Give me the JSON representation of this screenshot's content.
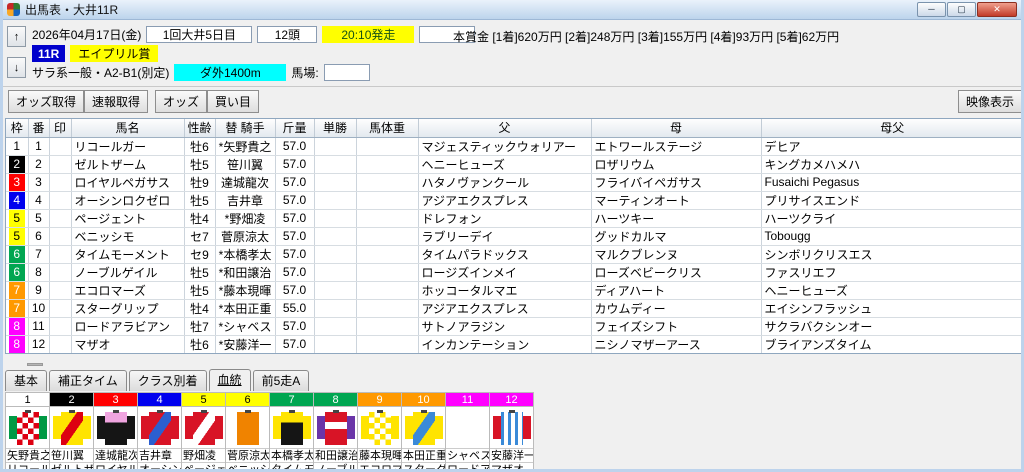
{
  "window": {
    "title": "出馬表・大井11R",
    "minimize": "─",
    "maximize": "▢",
    "close": "✕"
  },
  "header": {
    "up_arrow": "↑",
    "down_arrow": "↓",
    "date": "2026年04月17日(金)",
    "meeting": "1回大井5日目",
    "head_count": "12頭",
    "start_time": "20:10発走",
    "start_time_extra": "",
    "prize": "本賞金 [1着]620万円 [2着]248万円 [3着]155万円 [4着]93万円 [5着]62万円",
    "race_no": "11R",
    "race_name": "エイプリル賞",
    "race_class": "サラ系一般・A2-B1(別定)",
    "course": "ダ外1400m",
    "track_label": "馬場:",
    "track_value": ""
  },
  "toolbar": {
    "buttons": [
      "オッズ取得",
      "速報取得",
      "オッズ",
      "買い目"
    ],
    "video_button": "映像表示"
  },
  "frame_colors": {
    "1": {
      "bg": "#ffffff",
      "fg": "#000000"
    },
    "2": {
      "bg": "#000000",
      "fg": "#ffffff"
    },
    "3": {
      "bg": "#ff0000",
      "fg": "#ffffff"
    },
    "4": {
      "bg": "#0000ee",
      "fg": "#ffffff"
    },
    "5": {
      "bg": "#ffff00",
      "fg": "#000000"
    },
    "6": {
      "bg": "#00a651",
      "fg": "#ffffff"
    },
    "7": {
      "bg": "#ff9900",
      "fg": "#ffffff"
    },
    "8": {
      "bg": "#ff00ff",
      "fg": "#ffffff"
    }
  },
  "table": {
    "columns": [
      "枠",
      "番",
      "印",
      "馬名",
      "性齢",
      "替 騎手",
      "斤量",
      "単勝",
      "馬体重",
      "父",
      "母",
      "母父"
    ],
    "rows": [
      {
        "frame": 1,
        "num": "1",
        "mark": "",
        "name": "リコールガー",
        "sex_age": "牡6",
        "jockey": "*矢野貴之",
        "weight": "57.0",
        "odds": "",
        "body_weight": "",
        "sire": "マジェスティックウォリアー",
        "dam": "エトワールステージ",
        "dam_sire": "デヒア"
      },
      {
        "frame": 2,
        "num": "2",
        "mark": "",
        "name": "ゼルトザーム",
        "sex_age": "牡5",
        "jockey": "笹川翼",
        "weight": "57.0",
        "odds": "",
        "body_weight": "",
        "sire": "ヘニーヒューズ",
        "dam": "ロザリウム",
        "dam_sire": "キングカメハメハ"
      },
      {
        "frame": 3,
        "num": "3",
        "mark": "",
        "name": "ロイヤルペガサス",
        "sex_age": "牡9",
        "jockey": "達城龍次",
        "weight": "57.0",
        "odds": "",
        "body_weight": "",
        "sire": "ハタノヴァンクール",
        "dam": "フライバイペガサス",
        "dam_sire": "Fusaichi Pegasus"
      },
      {
        "frame": 4,
        "num": "4",
        "mark": "",
        "name": "オーシンロクゼロ",
        "sex_age": "牡5",
        "jockey": "吉井章",
        "weight": "57.0",
        "odds": "",
        "body_weight": "",
        "sire": "アジアエクスプレス",
        "dam": "マーティンオート",
        "dam_sire": "プリサイスエンド"
      },
      {
        "frame": 5,
        "num": "5",
        "mark": "",
        "name": "ページェント",
        "sex_age": "牡4",
        "jockey": "*野畑凌",
        "weight": "57.0",
        "odds": "",
        "body_weight": "",
        "sire": "ドレフォン",
        "dam": "ハーツキー",
        "dam_sire": "ハーツクライ"
      },
      {
        "frame": 5,
        "num": "6",
        "mark": "",
        "name": "ベニッシモ",
        "sex_age": "セ7",
        "jockey": "菅原涼太",
        "weight": "57.0",
        "odds": "",
        "body_weight": "",
        "sire": "ラブリーデイ",
        "dam": "グッドカルマ",
        "dam_sire": "Tobougg"
      },
      {
        "frame": 6,
        "num": "7",
        "mark": "",
        "name": "タイムモーメント",
        "sex_age": "セ9",
        "jockey": "*本橋孝太",
        "weight": "57.0",
        "odds": "",
        "body_weight": "",
        "sire": "タイムパラドックス",
        "dam": "マルクブレンヌ",
        "dam_sire": "シンボリクリスエス"
      },
      {
        "frame": 6,
        "num": "8",
        "mark": "",
        "name": "ノーブルゲイル",
        "sex_age": "牡5",
        "jockey": "*和田譲治",
        "weight": "57.0",
        "odds": "",
        "body_weight": "",
        "sire": "ロージズインメイ",
        "dam": "ローズベビークリス",
        "dam_sire": "ファスリエフ"
      },
      {
        "frame": 7,
        "num": "9",
        "mark": "",
        "name": "エコロマーズ",
        "sex_age": "牡5",
        "jockey": "*藤本現暉",
        "weight": "57.0",
        "odds": "",
        "body_weight": "",
        "sire": "ホッコータルマエ",
        "dam": "ディアハート",
        "dam_sire": "ヘニーヒューズ"
      },
      {
        "frame": 7,
        "num": "10",
        "mark": "",
        "name": "スターグリップ",
        "sex_age": "牡4",
        "jockey": "*本田正重",
        "weight": "55.0",
        "odds": "",
        "body_weight": "",
        "sire": "アジアエクスプレス",
        "dam": "カウムディー",
        "dam_sire": "エイシンフラッシュ"
      },
      {
        "frame": 8,
        "num": "11",
        "mark": "",
        "name": "ロードアラビアン",
        "sex_age": "牡7",
        "jockey": "*シャベス",
        "weight": "57.0",
        "odds": "",
        "body_weight": "",
        "sire": "サトノアラジン",
        "dam": "フェイズシフト",
        "dam_sire": "サクラバクシンオー"
      },
      {
        "frame": 8,
        "num": "12",
        "mark": "",
        "name": "マザオ",
        "sex_age": "牡6",
        "jockey": "*安藤洋一",
        "weight": "57.0",
        "odds": "",
        "body_weight": "",
        "sire": "インカンテーション",
        "dam": "ニシノマザーアース",
        "dam_sire": "ブライアンズタイム"
      }
    ]
  },
  "tabs": {
    "items": [
      "基本",
      "補正タイム",
      "クラス別着",
      "血統",
      "前5走A"
    ],
    "active": "血統"
  },
  "silks_panel": [
    {
      "num": "1",
      "frame": 1,
      "jockey": "矢野貴之",
      "horse": "リコールガー",
      "silk": {
        "body": "#ffffff",
        "sleeves": "#009944",
        "pattern": "check",
        "pattern_color": "#dd0011"
      }
    },
    {
      "num": "2",
      "frame": 2,
      "jockey": "笹川翼",
      "horse": "ゼルトザーム",
      "silk": {
        "body": "#ffe400",
        "sleeves": "#ffe400",
        "pattern": "sash",
        "pattern_color": "#dd0011"
      }
    },
    {
      "num": "3",
      "frame": 3,
      "jockey": "達城龍次",
      "horse": "ロイヤルペガサス",
      "silk": {
        "body": "#151515",
        "sleeves": "#151515",
        "pattern": "yoke",
        "pattern_color": "#f0a5e0"
      }
    },
    {
      "num": "4",
      "frame": 4,
      "jockey": "吉井章",
      "horse": "オーシンロクゼロ",
      "silk": {
        "body": "#d81426",
        "sleeves": "#d81426",
        "pattern": "sash",
        "pattern_color": "#2b5fd0"
      }
    },
    {
      "num": "5",
      "frame": 5,
      "jockey": "野畑凌",
      "horse": "ページェント",
      "silk": {
        "body": "#d81426",
        "sleeves": "#d81426",
        "pattern": "sash",
        "pattern_color": "#ffffff"
      }
    },
    {
      "num": "6",
      "frame": 5,
      "jockey": "菅原涼太",
      "horse": "ベニッシモ",
      "silk": {
        "body": "#f08300",
        "sleeves": "#ffffff",
        "pattern": "plain",
        "pattern_color": "#f08300"
      }
    },
    {
      "num": "7",
      "frame": 6,
      "jockey": "本橋孝太",
      "horse": "タイムモーメント",
      "silk": {
        "body": "#151515",
        "sleeves": "#ffe400",
        "pattern": "yoke",
        "pattern_color": "#ffe400"
      }
    },
    {
      "num": "8",
      "frame": 6,
      "jockey": "和田譲治",
      "horse": "ノーブルゲイル",
      "silk": {
        "body": "#d81426",
        "sleeves": "#6a35a8",
        "pattern": "zigzag",
        "pattern_color": "#ffffff"
      }
    },
    {
      "num": "9",
      "frame": 7,
      "jockey": "藤本現暉",
      "horse": "エコロマーズ",
      "silk": {
        "body": "#ffe400",
        "sleeves": "#ffe400",
        "pattern": "check",
        "pattern_color": "#ffffff"
      }
    },
    {
      "num": "10",
      "frame": 7,
      "jockey": "本田正重",
      "horse": "スターグリップ",
      "silk": {
        "body": "#ffe400",
        "sleeves": "#ffe400",
        "pattern": "sash",
        "pattern_color": "#3a8ad8"
      }
    },
    {
      "num": "11",
      "frame": 8,
      "jockey": "シャベス",
      "horse": "ロードアラビアン",
      "silk": null
    },
    {
      "num": "12",
      "frame": 8,
      "jockey": "安藤洋一",
      "horse": "マザオ",
      "silk": {
        "body": "#ffffff",
        "sleeves": "#d81426",
        "pattern": "stripes",
        "pattern_color": "#3a8ad8"
      }
    }
  ]
}
